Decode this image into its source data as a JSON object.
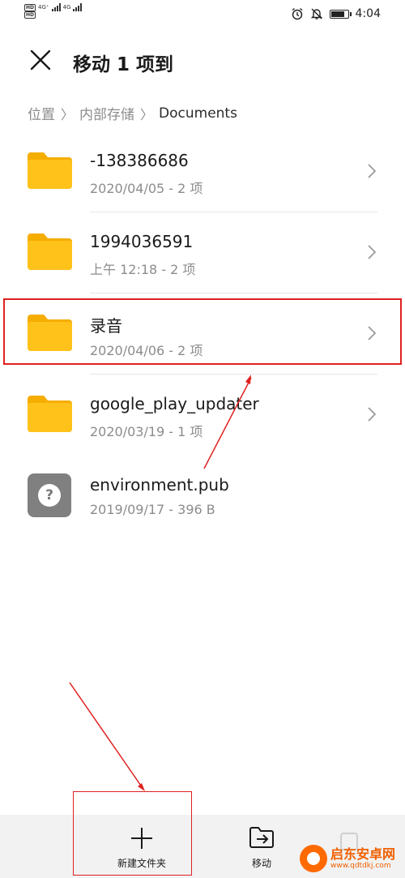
{
  "status_bar": {
    "time": "4:04",
    "left_row1": [
      "HD",
      "4G⁺",
      "4G"
    ],
    "left_row2": [
      "HD"
    ],
    "icons": [
      "alarm-icon",
      "mute-icon",
      "battery-icon"
    ]
  },
  "header": {
    "title": "移动 1 项到",
    "close_icon": "close-icon"
  },
  "breadcrumb": {
    "items": [
      "位置",
      "内部存储",
      "Documents"
    ]
  },
  "files": [
    {
      "name": "-138386686",
      "meta": "2020/04/05 - 2 项",
      "type": "folder"
    },
    {
      "name": "1994036591",
      "meta": "上午 12:18  - 2 项",
      "type": "folder"
    },
    {
      "name": "录音",
      "meta": "2020/04/06 - 2 项",
      "type": "folder"
    },
    {
      "name": "google_play_updater",
      "meta": "2020/03/19 - 1 项",
      "type": "folder"
    },
    {
      "name": "environment.pub",
      "meta": "2019/09/17 - 396 B",
      "type": "file"
    }
  ],
  "bottom_bar": {
    "new_folder_label": "新建文件夹",
    "move_label": "移动"
  },
  "watermark": {
    "title": "启东安卓网",
    "url": "www.qdtdkj.com"
  },
  "colors": {
    "folder": "#FFC21A",
    "folder_tab": "#F5AD00",
    "annotation": "#E02020",
    "bottom_bar": "#F2F2F2"
  }
}
